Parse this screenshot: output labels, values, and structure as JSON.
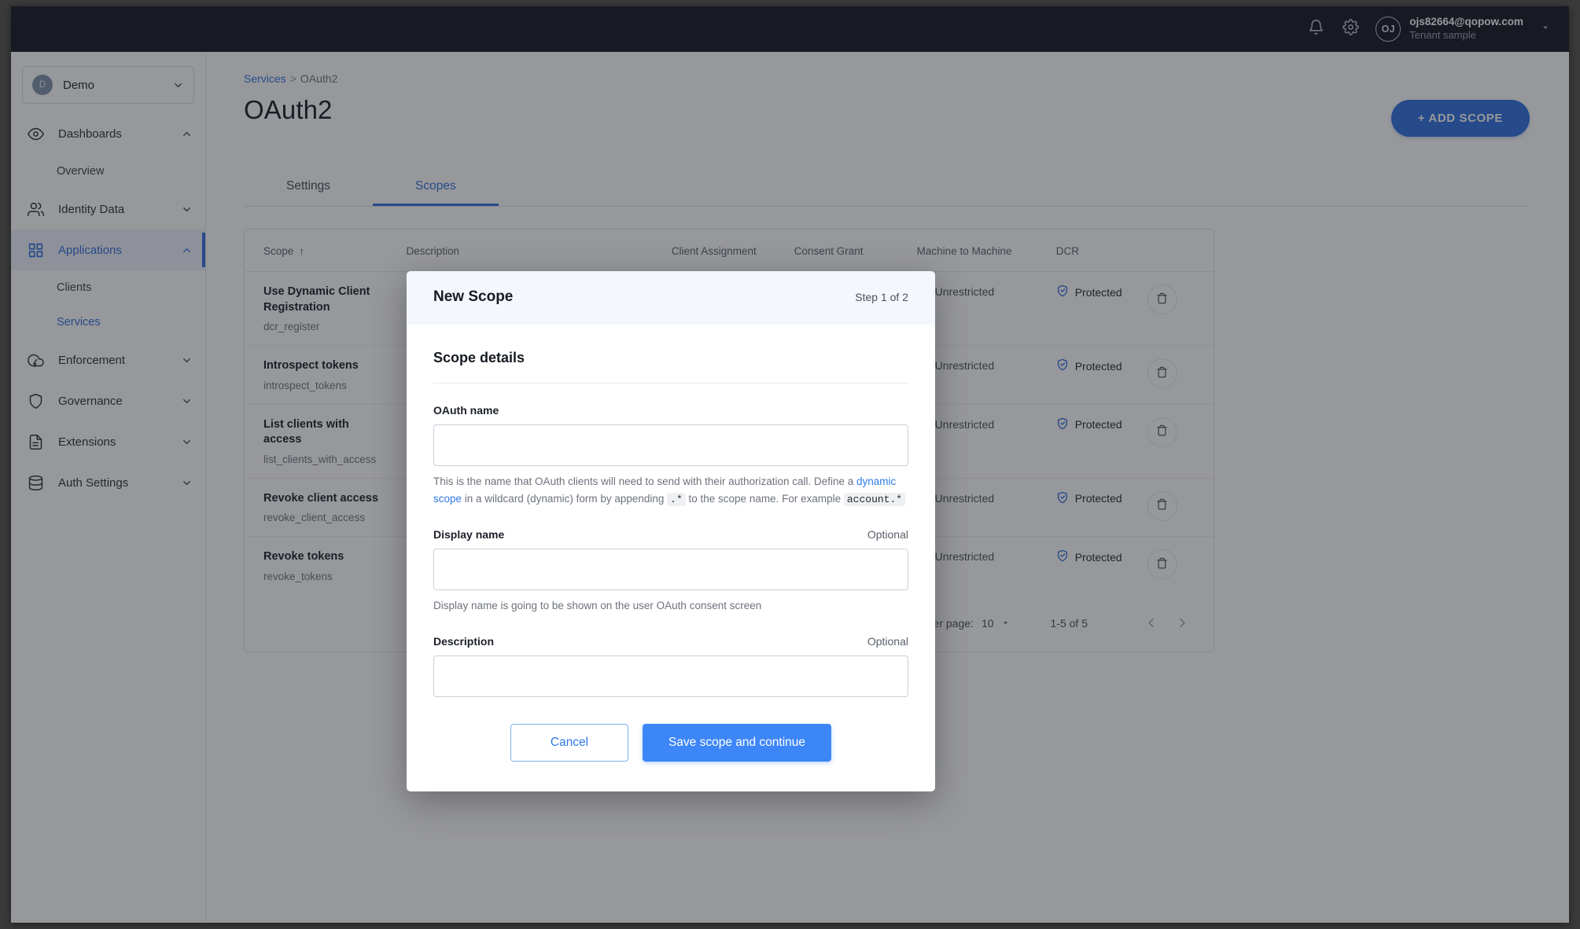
{
  "topbar": {
    "notification_icon": "bell-icon",
    "settings_icon": "gear-icon",
    "avatar_initials": "OJ",
    "user_email": "ojs82664@qopow.com",
    "tenant": "Tenant sample"
  },
  "sidebar": {
    "tenant": {
      "initial": "D",
      "name": "Demo"
    },
    "items": [
      {
        "label": "Dashboards",
        "icon": "eye-icon",
        "expanded": true,
        "active": false
      },
      {
        "label": "Overview",
        "sub": true,
        "selected": false
      },
      {
        "label": "Identity Data",
        "icon": "users-icon",
        "expanded": false,
        "active": false
      },
      {
        "label": "Applications",
        "icon": "grid-icon",
        "expanded": true,
        "active": true
      },
      {
        "label": "Clients",
        "sub": true,
        "selected": false
      },
      {
        "label": "Services",
        "sub": true,
        "selected": true
      },
      {
        "label": "Enforcement",
        "icon": "cloud-bolt-icon",
        "expanded": false,
        "active": false
      },
      {
        "label": "Governance",
        "icon": "shield-icon",
        "expanded": false,
        "active": false
      },
      {
        "label": "Extensions",
        "icon": "document-icon",
        "expanded": false,
        "active": false
      },
      {
        "label": "Auth Settings",
        "icon": "database-icon",
        "expanded": false,
        "active": false
      }
    ]
  },
  "breadcrumb": {
    "parent": "Services",
    "separator": ">",
    "current": "OAuth2"
  },
  "page": {
    "title": "OAuth2",
    "add_button": "+ ADD SCOPE"
  },
  "tabs": [
    {
      "label": "Settings",
      "active": false
    },
    {
      "label": "Scopes",
      "active": true
    }
  ],
  "table": {
    "columns": [
      "Scope",
      "Description",
      "Client Assignment",
      "Consent Grant",
      "Machine to Machine",
      "DCR"
    ],
    "sort_column": "Scope",
    "sort_direction": "asc",
    "rows": [
      {
        "name": "Use Dynamic Client Registration",
        "key": "dcr_register",
        "description": "",
        "client_assignment": "",
        "consent_grant": "",
        "machine_to_machine": "Unrestricted",
        "dcr": "Protected"
      },
      {
        "name": "Introspect tokens",
        "key": "introspect_tokens",
        "description": "",
        "client_assignment": "",
        "consent_grant": "",
        "machine_to_machine": "Unrestricted",
        "dcr": "Protected"
      },
      {
        "name": "List clients with access",
        "key": "list_clients_with_access",
        "description": "",
        "client_assignment": "",
        "consent_grant": "",
        "machine_to_machine": "Unrestricted",
        "dcr": "Protected"
      },
      {
        "name": "Revoke client access",
        "key": "revoke_client_access",
        "description": "",
        "client_assignment": "",
        "consent_grant": "",
        "machine_to_machine": "Unrestricted",
        "dcr": "Protected"
      },
      {
        "name": "Revoke tokens",
        "key": "revoke_tokens",
        "description": "",
        "client_assignment": "",
        "consent_grant": "",
        "machine_to_machine": "Unrestricted",
        "dcr": "Protected"
      }
    ],
    "pager": {
      "rows_per_page_label": "Rows per page:",
      "rows_per_page_value": "10",
      "range": "1-5 of 5",
      "prev_icon": "chevron-left-icon",
      "next_icon": "chevron-right-icon"
    }
  },
  "modal": {
    "title": "New Scope",
    "step": "Step 1 of 2",
    "section_title": "Scope details",
    "fields": {
      "oauth_name": {
        "label": "OAuth name",
        "value": "",
        "placeholder": "",
        "helper_pre": "This is the name that OAuth clients will need to send with their authorization call. Define a ",
        "helper_link": "dynamic scope",
        "helper_mid": " in a wildcard (dynamic) form by appending ",
        "helper_code1": ".*",
        "helper_mid2": " to the scope name. For example ",
        "helper_code2": "account.*"
      },
      "display_name": {
        "label": "Display name",
        "optional": "Optional",
        "value": "",
        "placeholder": "",
        "helper": "Display name is going to be shown on the user OAuth consent screen"
      },
      "description": {
        "label": "Description",
        "optional": "Optional",
        "value": "",
        "placeholder": ""
      }
    },
    "cancel_label": "Cancel",
    "save_label": "Save scope and continue"
  },
  "colors": {
    "accent": "#2f6fe0",
    "modal_primary": "#3d86f7",
    "topbar": "#141721",
    "shield": "#2f6fe0"
  }
}
